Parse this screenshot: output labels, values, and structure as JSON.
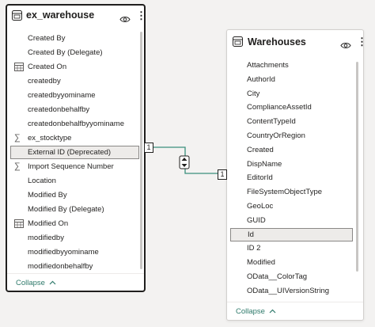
{
  "left_table": {
    "name": "ex_warehouse",
    "fields": [
      {
        "label": "Created By",
        "icon": "none"
      },
      {
        "label": "Created By (Delegate)",
        "icon": "none"
      },
      {
        "label": "Created On",
        "icon": "calendar-icon"
      },
      {
        "label": "createdby",
        "icon": "none"
      },
      {
        "label": "createdbyyominame",
        "icon": "none"
      },
      {
        "label": "createdonbehalfby",
        "icon": "none"
      },
      {
        "label": "createdonbehalfbyyominame",
        "icon": "none"
      },
      {
        "label": "ex_stocktype",
        "icon": "sigma-icon"
      },
      {
        "label": "External ID (Deprecated)",
        "icon": "none",
        "selected": true
      },
      {
        "label": "Import Sequence Number",
        "icon": "sigma-icon"
      },
      {
        "label": "Location",
        "icon": "none"
      },
      {
        "label": "Modified By",
        "icon": "none"
      },
      {
        "label": "Modified By (Delegate)",
        "icon": "none"
      },
      {
        "label": "Modified On",
        "icon": "calendar-icon"
      },
      {
        "label": "modifiedby",
        "icon": "none"
      },
      {
        "label": "modifiedbyyominame",
        "icon": "none"
      },
      {
        "label": "modifiedonbehalfby",
        "icon": "none"
      }
    ],
    "collapse_label": "Collapse"
  },
  "right_table": {
    "name": "Warehouses",
    "fields": [
      {
        "label": "Attachments"
      },
      {
        "label": "AuthorId"
      },
      {
        "label": "City"
      },
      {
        "label": "ComplianceAssetId"
      },
      {
        "label": "ContentTypeId"
      },
      {
        "label": "CountryOrRegion"
      },
      {
        "label": "Created"
      },
      {
        "label": "DispName"
      },
      {
        "label": "EditorId"
      },
      {
        "label": "FileSystemObjectType"
      },
      {
        "label": "GeoLoc"
      },
      {
        "label": "GUID"
      },
      {
        "label": "Id",
        "selected": true
      },
      {
        "label": "ID 2"
      },
      {
        "label": "Modified"
      },
      {
        "label": "OData__ColorTag"
      },
      {
        "label": "OData__UIVersionString"
      }
    ],
    "collapse_label": "Collapse"
  },
  "relationship": {
    "from_cardinality": "1",
    "to_cardinality": "1",
    "line_color": "#3a8f7c"
  },
  "colors": {
    "accent": "#2f7a6b",
    "selected_bg": "#edebe9",
    "canvas": "#f3f2f1"
  }
}
